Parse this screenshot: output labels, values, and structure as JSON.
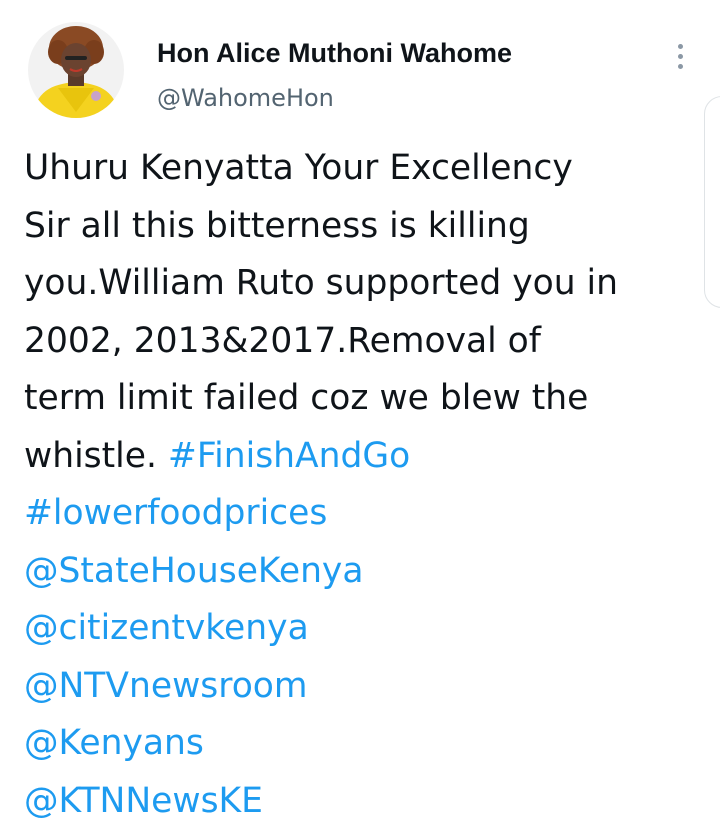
{
  "author": {
    "display_name": "Hon Alice Muthoni Wahome",
    "handle": "@WahomeHon",
    "avatar": "profile-photo"
  },
  "menu": {
    "icon": "more-vertical-icon"
  },
  "tweet": {
    "lines": [
      "Uhuru Kenyatta Your Excellency",
      "Sir all this bitterness is killing",
      "you.William Ruto supported you in",
      "2002, 2013&2017.Removal of",
      "term limit failed coz we blew the",
      "whistle. "
    ],
    "hashtags": [
      "#FinishAndGo",
      "#lowerfoodprices"
    ],
    "mentions": [
      "@StateHouseKenya",
      "@citizentvkenya",
      "@NTVnewsroom",
      "@Kenyans",
      "@KTNNewsKE"
    ]
  },
  "colors": {
    "link": "#1d9bf0",
    "text": "#0f1419",
    "secondary": "#536471"
  }
}
